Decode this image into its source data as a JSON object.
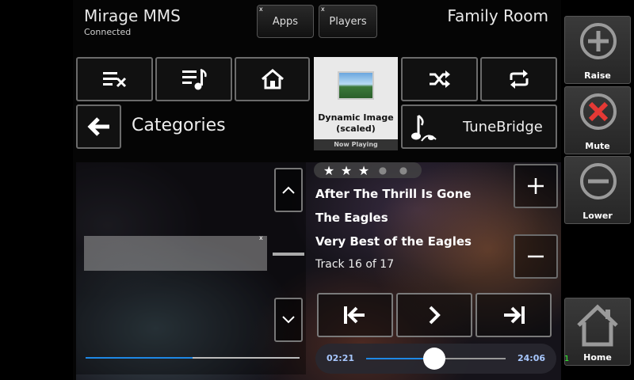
{
  "header": {
    "app_title": "Mirage MMS",
    "status": "Connected",
    "room": "Family Room",
    "apps_label": "Apps",
    "players_label": "Players",
    "close_mark": "x"
  },
  "browser": {
    "title": "Categories",
    "list_progress": 0.5
  },
  "art": {
    "label": "Dynamic Image (scaled)",
    "now_playing": "Now Playing"
  },
  "source": {
    "label": "TuneBridge",
    "icon": "music-note-icon"
  },
  "now_playing": {
    "rating": 3,
    "rating_max": 5,
    "title": "After The Thrill Is Gone",
    "artist": "The Eagles",
    "album": "Very Best of the Eagles",
    "track_info": "Track 16 of 17",
    "elapsed": "02:21",
    "total": "24:06",
    "progress": 0.49
  },
  "side": {
    "raise": "Raise",
    "mute": "Mute",
    "lower": "Lower",
    "home": "Home",
    "home_badge": "1"
  },
  "colors": {
    "accent": "#1e88e5",
    "mute_red": "#e53935"
  }
}
